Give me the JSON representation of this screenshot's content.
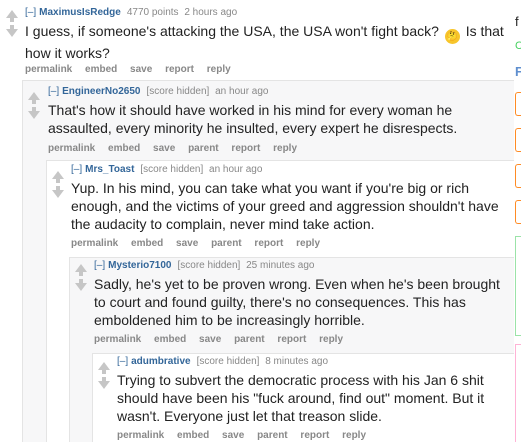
{
  "comments": [
    {
      "expand": "[–]",
      "author": "MaximusIsRedge",
      "score": "4770 points",
      "time": "2 hours ago",
      "text_before_emoji": "I guess, if someone's attacking the USA, the USA won't fight back?",
      "emoji": "🤔",
      "text_after_emoji": "Is that how it works?",
      "buttons": [
        "permalink",
        "embed",
        "save",
        "report",
        "reply"
      ]
    },
    {
      "expand": "[–]",
      "author": "EngineerNo2650",
      "score": "[score hidden]",
      "time": "an hour ago",
      "text": "That's how it should have worked in his mind for every woman he assaulted, every minority he insulted, every expert he disrespects.",
      "buttons": [
        "permalink",
        "embed",
        "save",
        "parent",
        "report",
        "reply"
      ]
    },
    {
      "expand": "[–]",
      "author": "Mrs_Toast",
      "score": "[score hidden]",
      "time": "an hour ago",
      "text": "Yup. In his mind, you can take what you want if you're big or rich enough, and the victims of your greed and aggression shouldn't have the audacity to complain, never mind take action.",
      "buttons": [
        "permalink",
        "embed",
        "save",
        "parent",
        "report",
        "reply"
      ]
    },
    {
      "expand": "[–]",
      "author": "Mysterio7100",
      "score": "[score hidden]",
      "time": "25 minutes ago",
      "text": "Sadly, he's yet to be proven wrong. Even when he's been brought to court and found guilty, there's no consequences. This has emboldened him to be increasingly horrible.",
      "buttons": [
        "permalink",
        "embed",
        "save",
        "parent",
        "report",
        "reply"
      ]
    },
    {
      "expand": "[–]",
      "author": "adumbrative",
      "score": "[score hidden]",
      "time": "8 minutes ago",
      "text": "Trying to subvert the democratic process with his Jan 6 shit should have been his \"fuck around, find out\" moment. But it wasn't. Everyone just let that treason slide.",
      "buttons": [
        "permalink",
        "embed",
        "save",
        "parent",
        "report",
        "reply"
      ]
    }
  ],
  "sidebar_fragments": [
    "f",
    "C",
    "F"
  ],
  "colors": {
    "author": "#336699",
    "meta": "#888888",
    "text": "#222222",
    "arrow": "#c6c6c6",
    "thread_line": "#e4e4e4",
    "sidebar_orange": "#ff8b24",
    "sidebar_green": "#46d160",
    "sidebar_pink": "#ff66ac"
  }
}
